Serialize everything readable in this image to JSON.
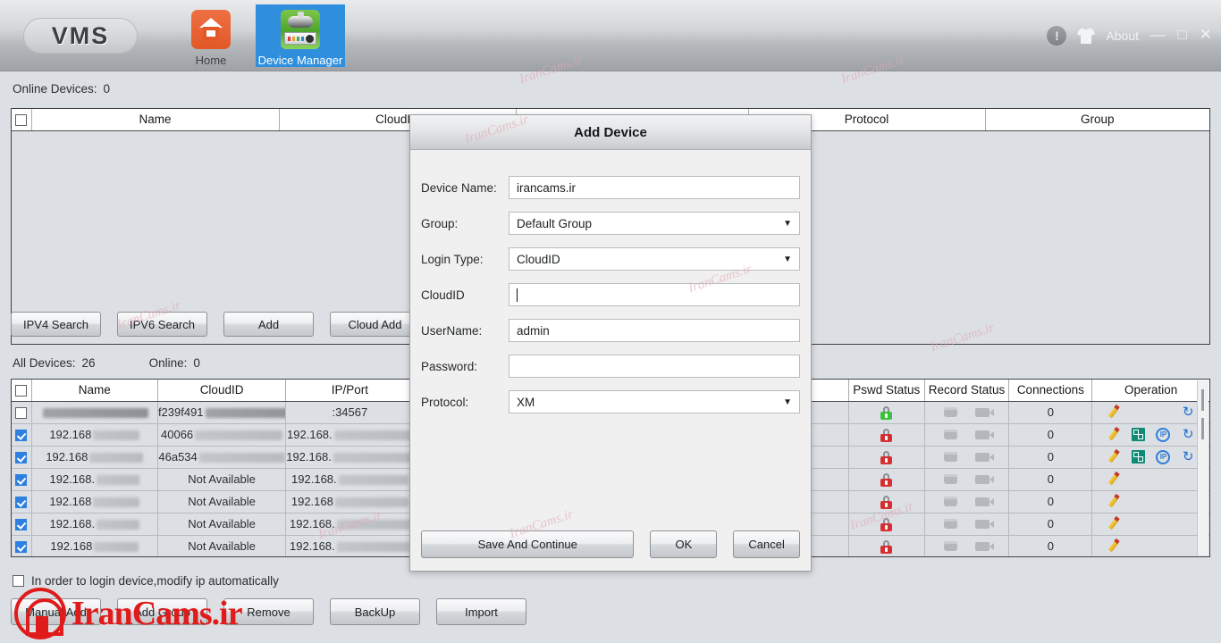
{
  "app": {
    "logo_text": "VMS",
    "nav": [
      {
        "label": "Home",
        "icon": "home-icon",
        "active": false
      },
      {
        "label": "Device Manager",
        "icon": "device-manager-icon",
        "active": true
      }
    ],
    "about_label": "About",
    "info_glyph": "!",
    "window_controls": {
      "minimize": "—",
      "maximize": "□",
      "close": "✕"
    },
    "accent_color": "#2f8fdd"
  },
  "online_section": {
    "label": "Online Devices:",
    "count": "0",
    "columns": [
      "",
      "Name",
      "CloudID",
      "",
      "Protocol",
      "Group"
    ],
    "rows": []
  },
  "search_buttons": [
    "IPV4 Search",
    "IPV6 Search",
    "Add",
    "Cloud Add"
  ],
  "all_section": {
    "all_label": "All Devices:",
    "all_count": "26",
    "online_label": "Online:",
    "online_count": "0",
    "columns": [
      "",
      "Name",
      "CloudID",
      "IP/Port",
      "Pswd Status",
      "Record Status",
      "Connections",
      "Operation"
    ],
    "rows": [
      {
        "checked": false,
        "name": "",
        "name_redacted": true,
        "cloudid": "f239f491",
        "cloudid_redacted": true,
        "ipport": ":34567",
        "ipport_redacted": false,
        "pswd": "green",
        "connections": "0",
        "ops": [
          "pencil",
          "",
          "",
          "refresh"
        ]
      },
      {
        "checked": true,
        "name": "192.168",
        "name_redacted": true,
        "cloudid": "40066",
        "cloudid_redacted": true,
        "ipport": "192.168.",
        "ipport_redacted": true,
        "pswd": "red",
        "connections": "0",
        "ops": [
          "pencil",
          "qr",
          "ip",
          "refresh"
        ]
      },
      {
        "checked": true,
        "name": "192.168",
        "name_redacted": true,
        "cloudid": "46a534",
        "cloudid_redacted": true,
        "ipport": "192.168.",
        "ipport_redacted": true,
        "pswd": "red",
        "connections": "0",
        "ops": [
          "pencil",
          "qr",
          "ip",
          "refresh"
        ]
      },
      {
        "checked": true,
        "name": "192.168.",
        "name_redacted": true,
        "cloudid": "Not Available",
        "cloudid_redacted": false,
        "ipport": "192.168.",
        "ipport_redacted": true,
        "pswd": "red",
        "connections": "0",
        "ops": [
          "pencil",
          "",
          "",
          ""
        ]
      },
      {
        "checked": true,
        "name": "192.168",
        "name_redacted": true,
        "cloudid": "Not Available",
        "cloudid_redacted": false,
        "ipport": "192.168",
        "ipport_redacted": true,
        "pswd": "red",
        "connections": "0",
        "ops": [
          "pencil",
          "",
          "",
          ""
        ]
      },
      {
        "checked": true,
        "name": "192.168.",
        "name_redacted": true,
        "cloudid": "Not Available",
        "cloudid_redacted": false,
        "ipport": "192.168.",
        "ipport_redacted": true,
        "pswd": "red",
        "connections": "0",
        "ops": [
          "pencil",
          "",
          "",
          ""
        ]
      },
      {
        "checked": true,
        "name": "192.168",
        "name_redacted": true,
        "cloudid": "Not Available",
        "cloudid_redacted": false,
        "ipport": "192.168.",
        "ipport_redacted": true,
        "pswd": "red",
        "connections": "0",
        "ops": [
          "pencil",
          "",
          "",
          ""
        ]
      }
    ]
  },
  "auto_ip_checkbox": {
    "label": "In order to login device,modify ip automatically",
    "checked": false
  },
  "bottom_buttons": [
    "Manual Add",
    "Add Group",
    "Remove",
    "BackUp",
    "Import"
  ],
  "dialog": {
    "title": "Add Device",
    "fields": [
      {
        "label": "Device Name:",
        "type": "text",
        "value": "irancams.ir"
      },
      {
        "label": "Group:",
        "type": "select",
        "value": "Default Group"
      },
      {
        "label": "Login Type:",
        "type": "select",
        "value": "CloudID"
      },
      {
        "label": "CloudID",
        "type": "text",
        "value": "",
        "focused": true
      },
      {
        "label": "UserName:",
        "type": "text",
        "value": "admin"
      },
      {
        "label": "Password:",
        "type": "password",
        "value": ""
      },
      {
        "label": "Protocol:",
        "type": "select",
        "value": "XM"
      }
    ],
    "buttons": [
      "Save And Continue",
      "OK",
      "Cancel"
    ]
  },
  "watermark": {
    "text": "IranCams.ir",
    "brand_color": "#e01b1b",
    "tile_color": "#e2a8b4"
  }
}
